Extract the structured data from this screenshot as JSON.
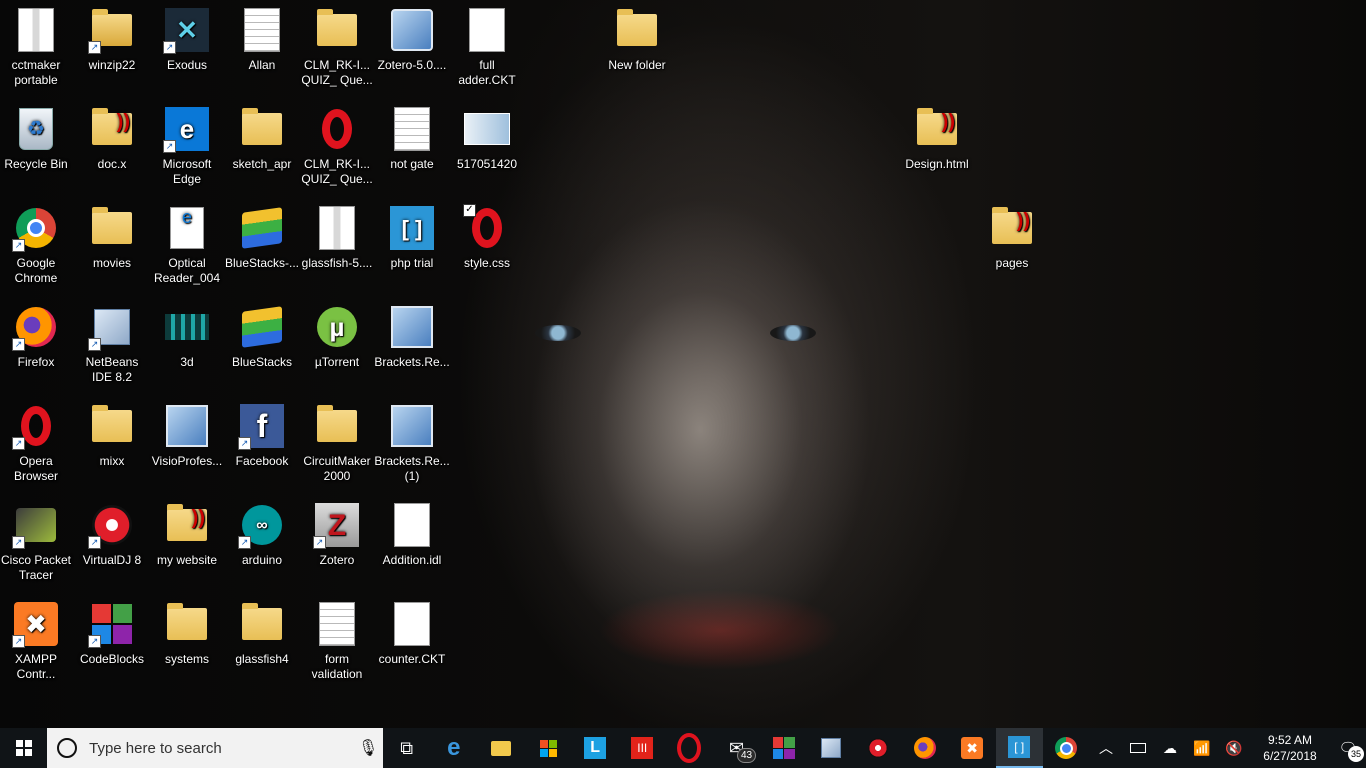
{
  "desktop": {
    "icons": [
      {
        "label": "cctmaker portable",
        "icon": "zip-folder-icon"
      },
      {
        "label": "winzip22",
        "icon": "winzip-icon"
      },
      {
        "label": "Exodus",
        "icon": "exodus-icon"
      },
      {
        "label": "Allan",
        "icon": "text-document-icon"
      },
      {
        "label": "CLM_RK-I... QUIZ_ Que...",
        "icon": "folder-icon"
      },
      {
        "label": "Zotero-5.0....",
        "icon": "installer-icon"
      },
      {
        "label": "full adder.CKT",
        "icon": "blank-file-icon"
      },
      {
        "label": "New folder",
        "icon": "folder-icon"
      },
      {
        "label": "Recycle Bin",
        "icon": "recycle-bin-icon"
      },
      {
        "label": "doc.x",
        "icon": "dreamweaver-folder-icon"
      },
      {
        "label": "Microsoft Edge",
        "icon": "edge-icon"
      },
      {
        "label": "sketch_apr",
        "icon": "folder-icon"
      },
      {
        "label": "CLM_RK-I... QUIZ_ Que...",
        "icon": "opera-icon"
      },
      {
        "label": "not gate",
        "icon": "text-document-icon"
      },
      {
        "label": "517051420",
        "icon": "image-file-icon"
      },
      {
        "label": "Design.html",
        "icon": "dreamweaver-folder-icon"
      },
      {
        "label": "Google Chrome",
        "icon": "chrome-icon"
      },
      {
        "label": "movies",
        "icon": "folder-icon"
      },
      {
        "label": "Optical Reader_004",
        "icon": "pdf-icon"
      },
      {
        "label": "BlueStacks-...",
        "icon": "bluestacks-icon"
      },
      {
        "label": "glassfish-5....",
        "icon": "zip-folder-icon"
      },
      {
        "label": "php trial",
        "icon": "brackets-icon"
      },
      {
        "label": "style.css",
        "icon": "opera-icon"
      },
      {
        "label": "pages",
        "icon": "dreamweaver-folder-icon"
      },
      {
        "label": "Firefox",
        "icon": "firefox-icon"
      },
      {
        "label": "NetBeans IDE 8.2",
        "icon": "netbeans-icon"
      },
      {
        "label": "3d",
        "icon": "game-3d-icon"
      },
      {
        "label": "BlueStacks",
        "icon": "bluestacks-icon"
      },
      {
        "label": "µTorrent",
        "icon": "utorrent-icon"
      },
      {
        "label": "Brackets.Re...",
        "icon": "setup-icon"
      },
      {
        "label": "Opera Browser",
        "icon": "opera-icon"
      },
      {
        "label": "mixx",
        "icon": "folder-icon"
      },
      {
        "label": "VisioProfes...",
        "icon": "setup-icon"
      },
      {
        "label": "Facebook",
        "icon": "facebook-icon"
      },
      {
        "label": "CircuitMaker 2000",
        "icon": "folder-icon"
      },
      {
        "label": "Brackets.Re... (1)",
        "icon": "setup-icon"
      },
      {
        "label": "Cisco Packet Tracer",
        "icon": "cisco-icon"
      },
      {
        "label": "VirtualDJ 8",
        "icon": "virtualdj-icon"
      },
      {
        "label": "my website",
        "icon": "dreamweaver-folder-icon"
      },
      {
        "label": "arduino",
        "icon": "arduino-icon"
      },
      {
        "label": "Zotero",
        "icon": "zotero-icon"
      },
      {
        "label": "Addition.idl",
        "icon": "blank-file-icon"
      },
      {
        "label": "XAMPP Contr...",
        "icon": "xampp-icon"
      },
      {
        "label": "CodeBlocks",
        "icon": "codeblocks-icon"
      },
      {
        "label": "systems",
        "icon": "folder-icon"
      },
      {
        "label": "glassfish4",
        "icon": "folder-icon"
      },
      {
        "label": "form validation",
        "icon": "text-document-icon"
      },
      {
        "label": "counter.CKT",
        "icon": "blank-file-icon"
      }
    ]
  },
  "taskbar": {
    "search_placeholder": "Type here to search",
    "pinned": [
      {
        "name": "task-view",
        "icon": "task-view-icon"
      },
      {
        "name": "edge",
        "icon": "edge-icon"
      },
      {
        "name": "file-explorer",
        "icon": "folder-icon"
      },
      {
        "name": "store",
        "icon": "store-icon"
      },
      {
        "name": "lync",
        "icon": "l-app-icon"
      },
      {
        "name": "media-app",
        "icon": "red-app-icon"
      },
      {
        "name": "opera",
        "icon": "opera-icon"
      },
      {
        "name": "mail",
        "icon": "mail-icon",
        "badge": "43"
      },
      {
        "name": "codeblocks",
        "icon": "codeblocks-icon"
      },
      {
        "name": "netbeans",
        "icon": "netbeans-icon"
      },
      {
        "name": "virtualdj",
        "icon": "virtualdj-icon"
      },
      {
        "name": "firefox",
        "icon": "firefox-icon"
      },
      {
        "name": "xampp",
        "icon": "xampp-icon"
      },
      {
        "name": "brackets",
        "icon": "brackets-icon"
      },
      {
        "name": "chrome",
        "icon": "chrome-icon"
      }
    ],
    "clock": {
      "time": "9:52 AM",
      "date": "6/27/2018"
    },
    "notifications_count": "35"
  }
}
